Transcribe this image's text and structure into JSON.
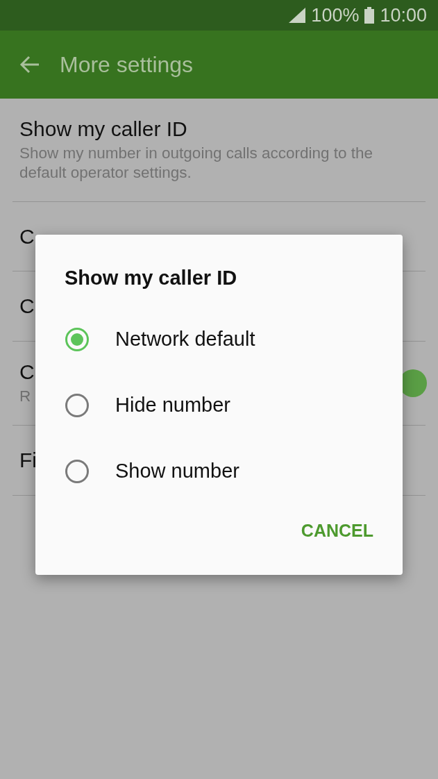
{
  "status_bar": {
    "battery": "100%",
    "time": "10:00"
  },
  "app_bar": {
    "title": "More settings"
  },
  "settings": [
    {
      "title": "Show my caller ID",
      "subtitle": "Show my number in outgoing calls according to the default operator settings."
    },
    {
      "title": "C"
    },
    {
      "title": "C"
    },
    {
      "title": "C",
      "subtitle": "R",
      "toggle": {
        "on": true
      }
    },
    {
      "title": "Fi"
    }
  ],
  "dialog": {
    "title": "Show my caller ID",
    "options": [
      {
        "label": "Network default",
        "selected": true
      },
      {
        "label": "Hide number",
        "selected": false
      },
      {
        "label": "Show number",
        "selected": false
      }
    ],
    "buttons": [
      "CANCEL"
    ]
  }
}
